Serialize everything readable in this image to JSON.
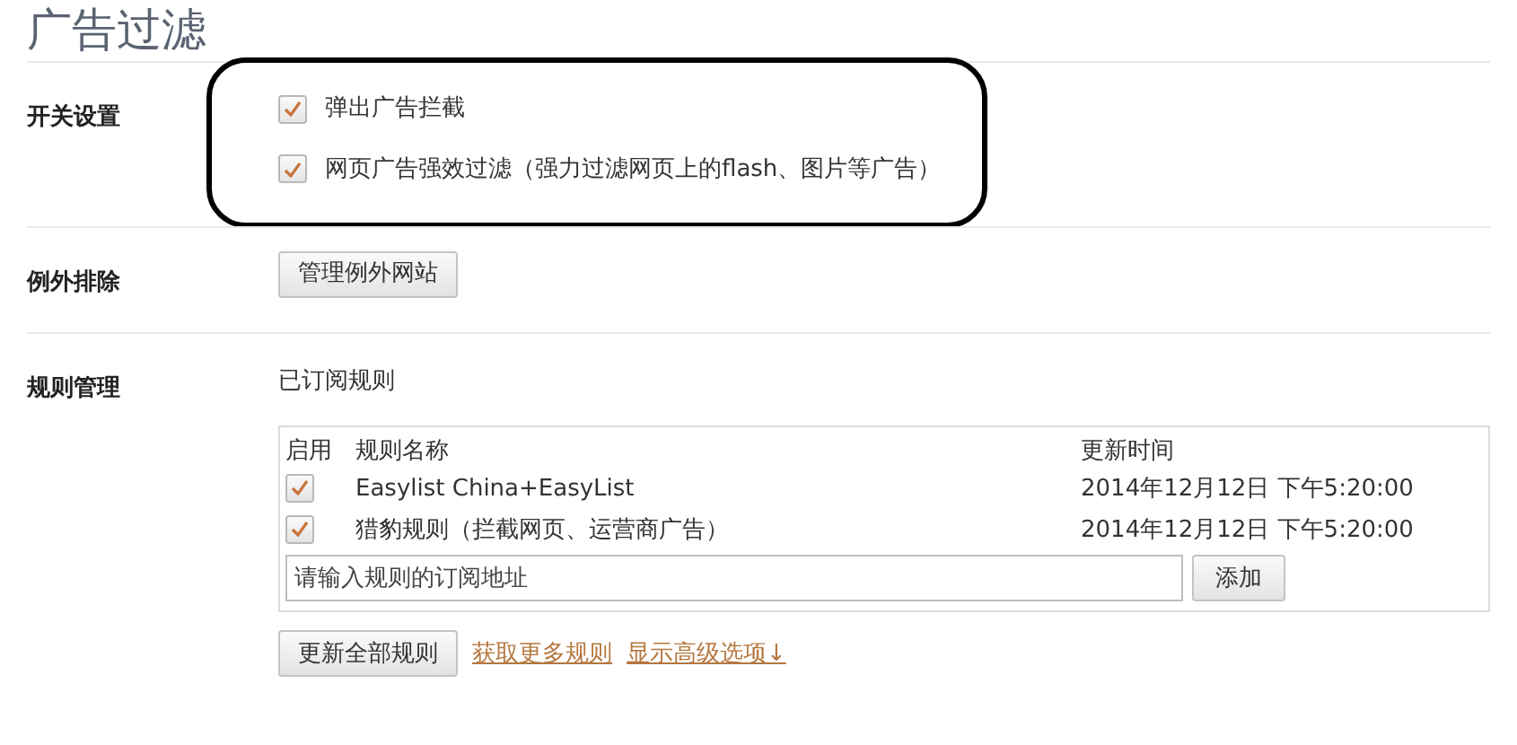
{
  "title": "广告过滤",
  "sections": [
    {
      "kind": "toggles",
      "label": "开关设置",
      "options": [
        {
          "label": "弹出广告拦截",
          "checked": true
        },
        {
          "label": "网页广告强效过滤（强力过滤网页上的flash、图片等广告）",
          "checked": true
        }
      ],
      "highlighted": true
    },
    {
      "kind": "button",
      "label": "例外排除",
      "button": "管理例外网站"
    },
    {
      "kind": "rules",
      "label": "规则管理",
      "subtitle": "已订阅规则",
      "columns": [
        "启用",
        "规则名称",
        "更新时间"
      ],
      "rows": [
        {
          "enabled": true,
          "name": "Easylist China+EasyList",
          "time": "2014年12月12日 下午5:20:00"
        },
        {
          "enabled": true,
          "name": "猎豹规则（拦截网页、运营商广告）",
          "time": "2014年12月12日 下午5:20:00"
        }
      ],
      "input": {
        "placeholder": "请输入规则的订阅地址"
      },
      "add_button": "添加",
      "update_button": "更新全部规则",
      "links": [
        "获取更多规则",
        "显示高级选项↓"
      ]
    }
  ]
}
